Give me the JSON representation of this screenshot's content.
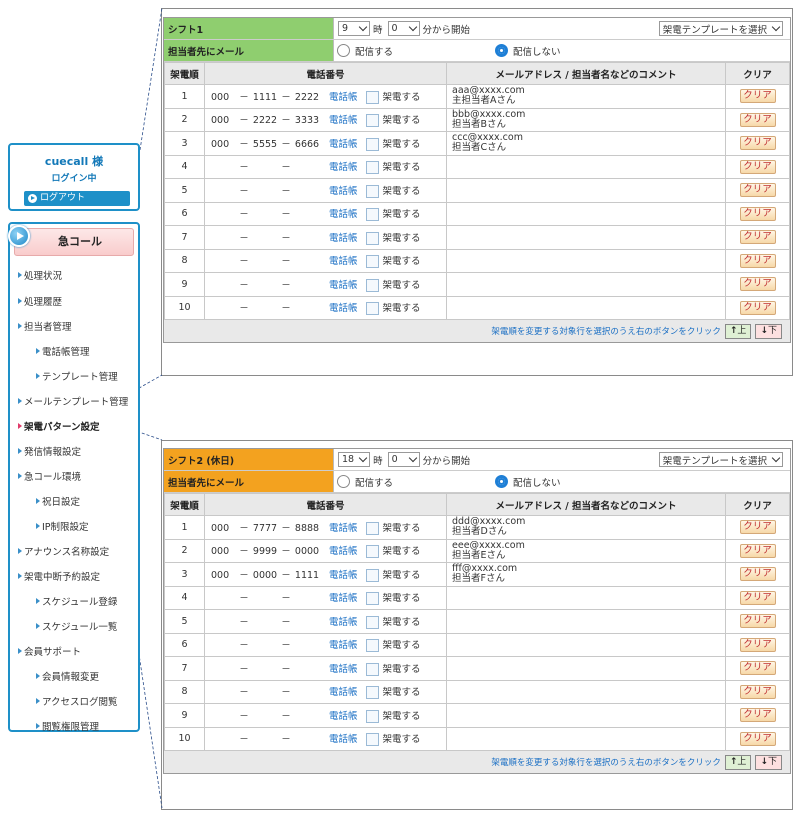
{
  "login": {
    "user": "cuecall",
    "honorific": "様",
    "status": "ログイン中",
    "logout": "ログアウト"
  },
  "menu": {
    "header": "急コール",
    "items": [
      {
        "label": "処理状況",
        "sub": false,
        "active": false
      },
      {
        "label": "処理履歴",
        "sub": false,
        "active": false
      },
      {
        "label": "担当者管理",
        "sub": false,
        "active": false
      },
      {
        "label": "電話帳管理",
        "sub": true,
        "active": false
      },
      {
        "label": "テンプレート管理",
        "sub": true,
        "active": false
      },
      {
        "label": "メールテンプレート管理",
        "sub": false,
        "active": false
      },
      {
        "label": "架電パターン設定",
        "sub": false,
        "active": true
      },
      {
        "label": "発信情報設定",
        "sub": false,
        "active": false
      },
      {
        "label": "急コール環境",
        "sub": false,
        "active": false
      },
      {
        "label": "祝日設定",
        "sub": true,
        "active": false
      },
      {
        "label": "IP制限設定",
        "sub": true,
        "active": false
      },
      {
        "label": "アナウンス名称設定",
        "sub": false,
        "active": false
      },
      {
        "label": "架電中断予約設定",
        "sub": false,
        "active": false
      },
      {
        "label": "スケジュール登録",
        "sub": true,
        "active": false
      },
      {
        "label": "スケジュール一覧",
        "sub": true,
        "active": false
      },
      {
        "label": "会員サポート",
        "sub": false,
        "active": false
      },
      {
        "label": "会員情報変更",
        "sub": true,
        "active": false
      },
      {
        "label": "アクセスログ閲覧",
        "sub": true,
        "active": false
      },
      {
        "label": "閲覧権限管理",
        "sub": true,
        "active": false
      }
    ]
  },
  "common": {
    "hour_label": "時",
    "minute_label": "分から開始",
    "template_select": "架電テンプレートを選択",
    "mail_label": "担当者先にメール",
    "radio_send": "配信する",
    "radio_nosend": "配信しない",
    "col_order": "架電順",
    "col_phone": "電話番号",
    "col_mail": "メールアドレス / 担当者名などのコメント",
    "col_clear": "クリア",
    "dial_link": "電話帳",
    "call_check": "架電する",
    "clear_btn": "クリア",
    "dash": "－",
    "footer_note": "架電順を変更する対象行を選択のうえ右のボタンをクリック",
    "up_btn": "上",
    "down_btn": "下"
  },
  "shift1": {
    "title": "シフト1",
    "hour": "9",
    "minute": "0",
    "color": "#8fce6f",
    "rows": [
      {
        "no": "1",
        "p1": "000",
        "p2": "1111",
        "p3": "2222",
        "mail": "aaa@xxxx.com",
        "comment": "主担当者Aさん"
      },
      {
        "no": "2",
        "p1": "000",
        "p2": "2222",
        "p3": "3333",
        "mail": "bbb@xxxx.com",
        "comment": "担当者Bさん"
      },
      {
        "no": "3",
        "p1": "000",
        "p2": "5555",
        "p3": "6666",
        "mail": "ccc@xxxx.com",
        "comment": "担当者Cさん"
      },
      {
        "no": "4",
        "p1": "",
        "p2": "",
        "p3": "",
        "mail": "",
        "comment": ""
      },
      {
        "no": "5",
        "p1": "",
        "p2": "",
        "p3": "",
        "mail": "",
        "comment": ""
      },
      {
        "no": "6",
        "p1": "",
        "p2": "",
        "p3": "",
        "mail": "",
        "comment": ""
      },
      {
        "no": "7",
        "p1": "",
        "p2": "",
        "p3": "",
        "mail": "",
        "comment": ""
      },
      {
        "no": "8",
        "p1": "",
        "p2": "",
        "p3": "",
        "mail": "",
        "comment": ""
      },
      {
        "no": "9",
        "p1": "",
        "p2": "",
        "p3": "",
        "mail": "",
        "comment": ""
      },
      {
        "no": "10",
        "p1": "",
        "p2": "",
        "p3": "",
        "mail": "",
        "comment": ""
      }
    ]
  },
  "shift2": {
    "title": "シフト2 (休日)",
    "hour": "18",
    "minute": "0",
    "color": "#f3a21f",
    "rows": [
      {
        "no": "1",
        "p1": "000",
        "p2": "7777",
        "p3": "8888",
        "mail": "ddd@xxxx.com",
        "comment": "担当者Dさん"
      },
      {
        "no": "2",
        "p1": "000",
        "p2": "9999",
        "p3": "0000",
        "mail": "eee@xxxx.com",
        "comment": "担当者Eさん"
      },
      {
        "no": "3",
        "p1": "000",
        "p2": "0000",
        "p3": "1111",
        "mail": "fff@xxxx.com",
        "comment": "担当者Fさん"
      },
      {
        "no": "4",
        "p1": "",
        "p2": "",
        "p3": "",
        "mail": "",
        "comment": ""
      },
      {
        "no": "5",
        "p1": "",
        "p2": "",
        "p3": "",
        "mail": "",
        "comment": ""
      },
      {
        "no": "6",
        "p1": "",
        "p2": "",
        "p3": "",
        "mail": "",
        "comment": ""
      },
      {
        "no": "7",
        "p1": "",
        "p2": "",
        "p3": "",
        "mail": "",
        "comment": ""
      },
      {
        "no": "8",
        "p1": "",
        "p2": "",
        "p3": "",
        "mail": "",
        "comment": ""
      },
      {
        "no": "9",
        "p1": "",
        "p2": "",
        "p3": "",
        "mail": "",
        "comment": ""
      },
      {
        "no": "10",
        "p1": "",
        "p2": "",
        "p3": "",
        "mail": "",
        "comment": ""
      }
    ]
  }
}
